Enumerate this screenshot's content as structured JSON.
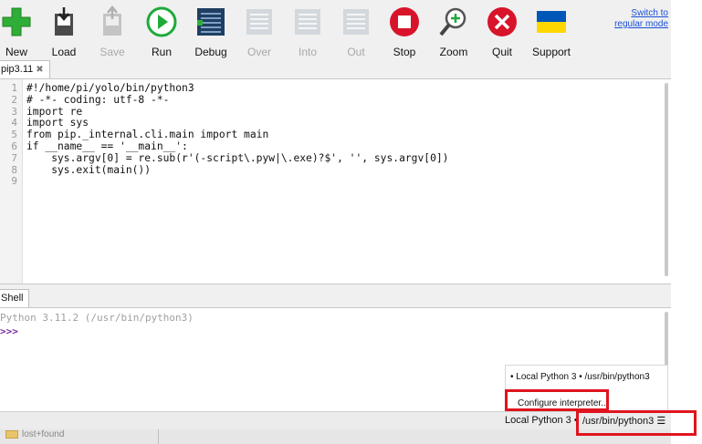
{
  "toolbar": {
    "buttons": [
      {
        "label": "New",
        "icon": "new-plus-icon",
        "enabled": true
      },
      {
        "label": "Load",
        "icon": "load-icon",
        "enabled": true
      },
      {
        "label": "Save",
        "icon": "save-icon",
        "enabled": false
      },
      {
        "label": "Run",
        "icon": "run-icon",
        "enabled": true
      },
      {
        "label": "Debug",
        "icon": "debug-icon",
        "enabled": true
      },
      {
        "label": "Over",
        "icon": "step-over-icon",
        "enabled": false
      },
      {
        "label": "Into",
        "icon": "step-into-icon",
        "enabled": false
      },
      {
        "label": "Out",
        "icon": "step-out-icon",
        "enabled": false
      },
      {
        "label": "Stop",
        "icon": "stop-icon",
        "enabled": true
      },
      {
        "label": "Zoom",
        "icon": "zoom-icon",
        "enabled": true
      },
      {
        "label": "Quit",
        "icon": "quit-icon",
        "enabled": true
      },
      {
        "label": "Support",
        "icon": "ukraine-flag-icon",
        "enabled": true
      }
    ],
    "switch_mode": "Switch to regular mode"
  },
  "editor": {
    "tab_label": "pip3.11",
    "tab_close": "✖",
    "lines": [
      "#!/home/pi/yolo/bin/python3",
      "# -*- coding: utf-8 -*-",
      "import re",
      "import sys",
      "from pip._internal.cli.main import main",
      "if __name__ == '__main__':",
      "    sys.argv[0] = re.sub(r'(-script\\.pyw|\\.exe)?$', '', sys.argv[0])",
      "    sys.exit(main())",
      ""
    ]
  },
  "shell": {
    "tab_label": "Shell",
    "banner": "Python 3.11.2 (/usr/bin/python3)",
    "prompt": ">>>"
  },
  "interpreter_menu": {
    "current_item": "• Local Python 3  •  /usr/bin/python3",
    "configure": "Configure interpreter..."
  },
  "status_bar": {
    "interpreter": "Local Python 3  •",
    "path": "/usr/bin/python3 ☰"
  },
  "files": {
    "folder": "lost+found"
  },
  "colors": {
    "highlight": "#e0141e",
    "link": "#1a4fd6",
    "run_green": "#1faa3b",
    "stop_red": "#d8142a",
    "flag_blue": "#0057b7",
    "flag_yellow": "#ffd700"
  }
}
